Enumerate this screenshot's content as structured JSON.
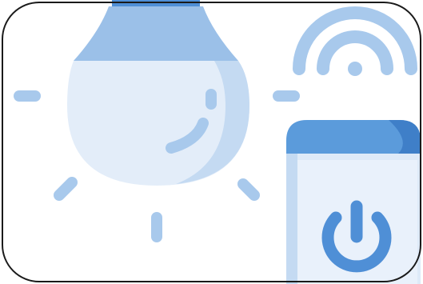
{
  "illustration": {
    "subject": "smart-bulb-with-remote",
    "icons": [
      "light-bulb-icon",
      "wifi-signal-icon",
      "remote-control-icon",
      "power-icon"
    ],
    "colors": {
      "bulb_glass": "#e3edf9",
      "bulb_shade": "#c4daf2",
      "bulb_cap": "#9bc0e8",
      "accent_blue": "#4f8fd6",
      "ray": "#a8c9ec",
      "remote_body": "#deeaf8",
      "remote_top": "#5b9bdb",
      "frame_border": "#1a1a1a"
    }
  }
}
